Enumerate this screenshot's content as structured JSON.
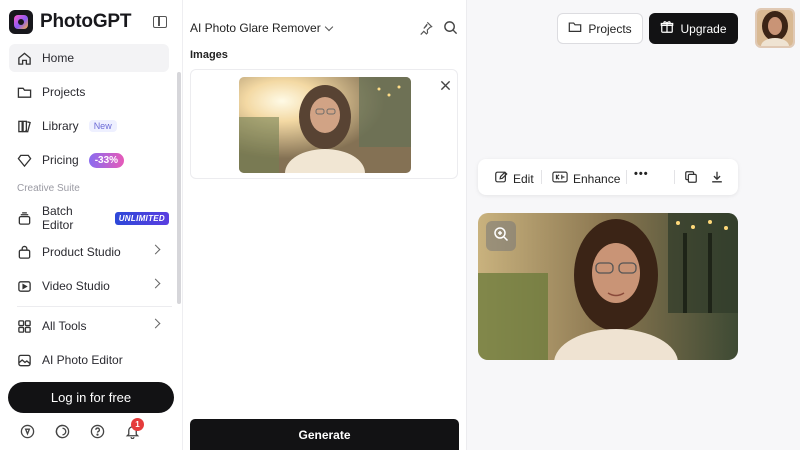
{
  "app": {
    "name": "PhotoGPT"
  },
  "sidebar": {
    "items": [
      {
        "label": "Home",
        "icon": "home-icon"
      },
      {
        "label": "Projects",
        "icon": "folder-icon"
      },
      {
        "label": "Library",
        "icon": "library-icon",
        "badge": "New"
      },
      {
        "label": "Pricing",
        "icon": "diamond-icon",
        "badge": "-33%"
      }
    ],
    "section_label": "Creative Suite",
    "suite_items": [
      {
        "label": "Batch Editor",
        "icon": "stack-icon",
        "badge": "UNLIMITED"
      },
      {
        "label": "Product Studio",
        "icon": "bag-icon"
      },
      {
        "label": "Video Studio",
        "icon": "video-icon"
      }
    ],
    "more_items": [
      {
        "label": "All Tools",
        "icon": "grid-icon"
      },
      {
        "label": "AI Photo Editor",
        "icon": "photo-edit-icon"
      }
    ],
    "login_label": "Log in for free",
    "notification_count": "1"
  },
  "tool_panel": {
    "title": "AI Photo Glare Remover",
    "images_label": "Images",
    "generate_label": "Generate"
  },
  "header": {
    "projects_label": "Projects",
    "upgrade_label": "Upgrade"
  },
  "result_toolbar": {
    "edit_label": "Edit",
    "enhance_label": "Enhance",
    "more_label": "•••"
  },
  "colors": {
    "primary_dark": "#121214",
    "accent_purple": "#8a6cf0",
    "accent_pink": "#e65ab8",
    "badge_blue": "#2d48d8",
    "notification_red": "#e53b3b"
  }
}
